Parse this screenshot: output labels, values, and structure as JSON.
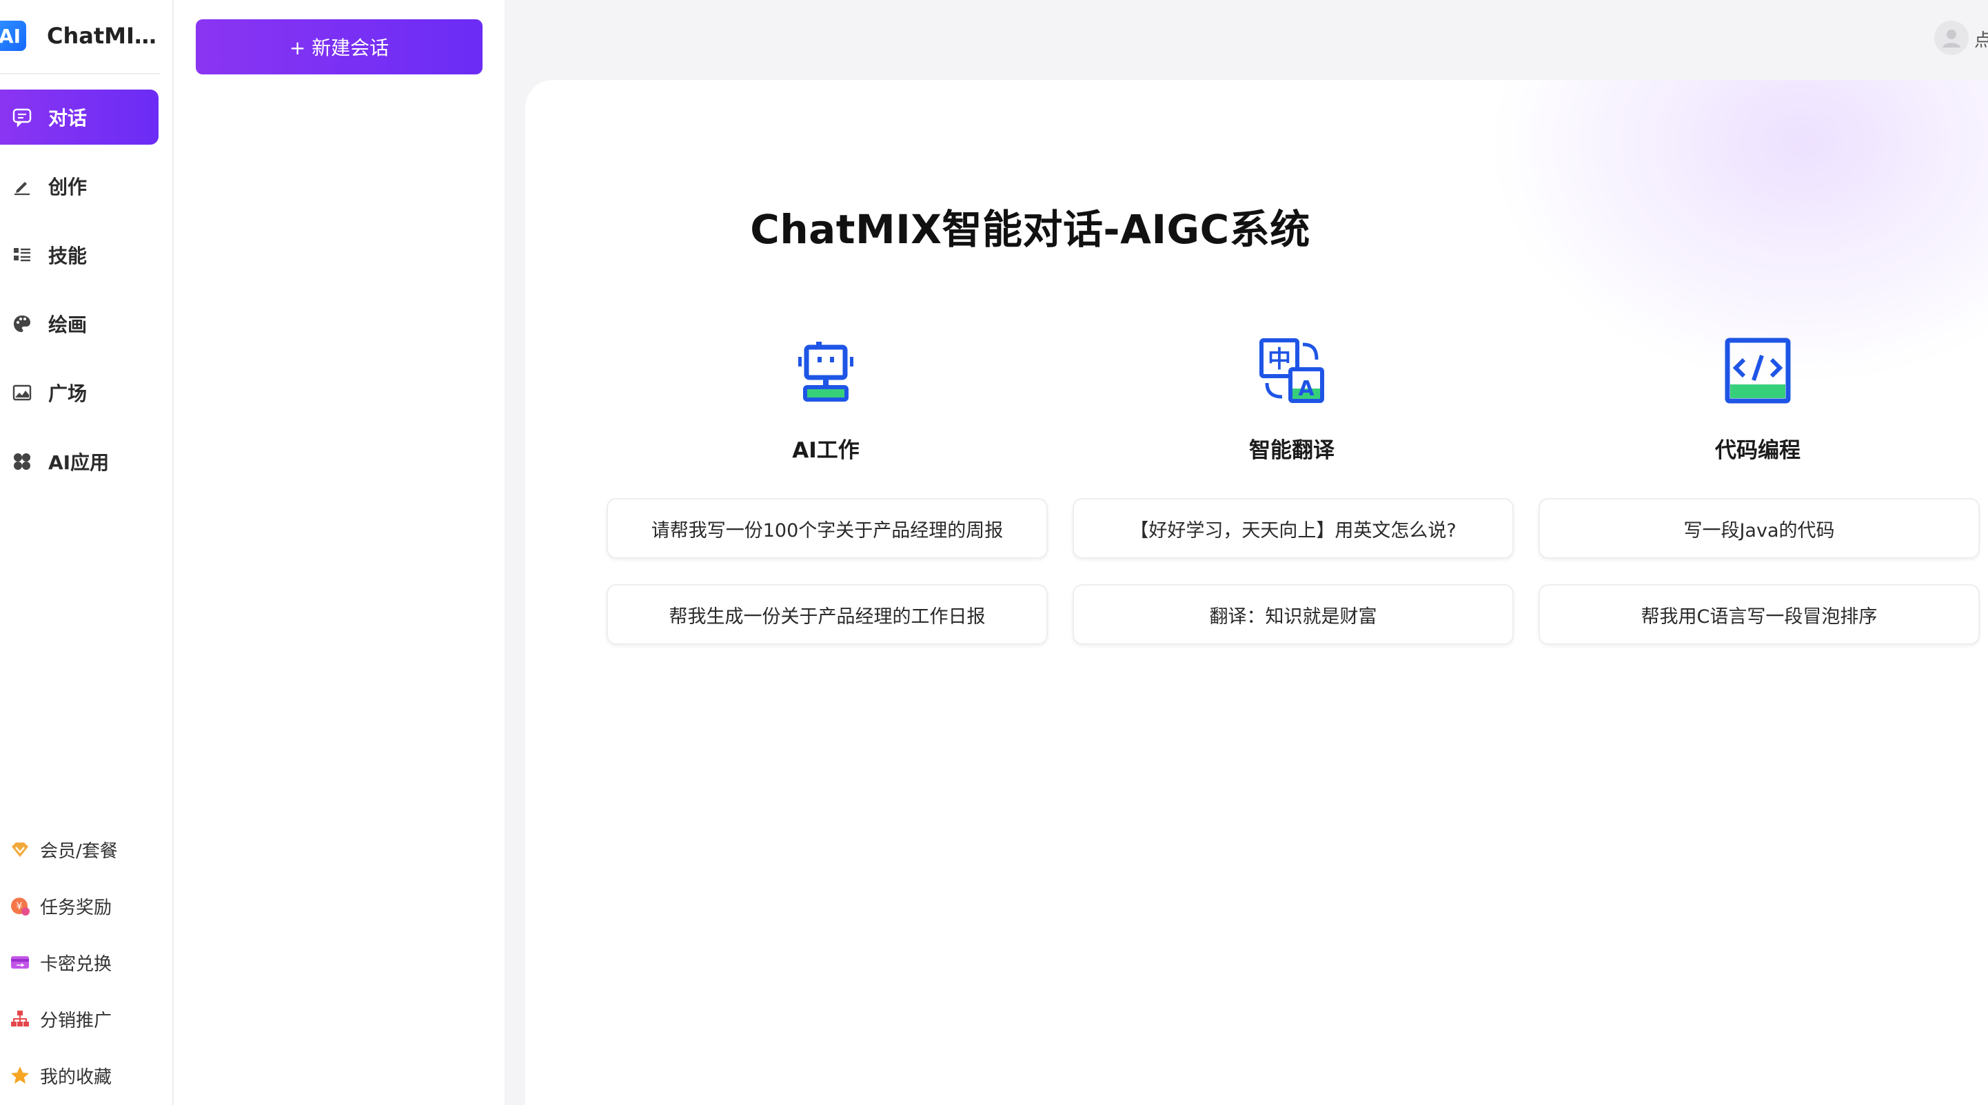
{
  "brand": {
    "logo_text": "AI",
    "name": "ChatMIX..."
  },
  "nav": {
    "items": [
      {
        "label": "对话",
        "icon": "chat-bubble-icon",
        "active": true
      },
      {
        "label": "创作",
        "icon": "pen-icon"
      },
      {
        "label": "技能",
        "icon": "list-icon"
      },
      {
        "label": "绘画",
        "icon": "palette-icon"
      },
      {
        "label": "广场",
        "icon": "image-icon"
      },
      {
        "label": "AI应用",
        "icon": "apps-grid-icon"
      }
    ],
    "bottom": [
      {
        "label": "会员/套餐",
        "icon": "vip-diamond-icon"
      },
      {
        "label": "任务奖励",
        "icon": "reward-coin-icon"
      },
      {
        "label": "卡密兑换",
        "icon": "card-exchange-icon"
      },
      {
        "label": "分销推广",
        "icon": "org-chart-icon"
      },
      {
        "label": "我的收藏",
        "icon": "star-icon"
      }
    ]
  },
  "sessions": {
    "new_chat_label": "+ 新建会话"
  },
  "header": {
    "avatar_text": "点"
  },
  "main": {
    "title": "ChatMIX智能对话-AIGC系统",
    "columns": [
      {
        "title": "AI工作",
        "icon": "robot-icon",
        "prompts": [
          "请帮我写一份100个字关于产品经理的周报",
          "帮我生成一份关于产品经理的工作日报"
        ]
      },
      {
        "title": "智能翻译",
        "icon": "translate-icon",
        "prompts": [
          "【好好学习，天天向上】用英文怎么说?",
          "翻译：知识就是财富"
        ]
      },
      {
        "title": "代码编程",
        "icon": "code-icon",
        "prompts": [
          "写一段Java的代码",
          "帮我用C语言写一段冒泡排序"
        ]
      }
    ]
  },
  "colors": {
    "accent_start": "#8a35f2",
    "accent_end": "#6b2cf5",
    "icon_blue": "#1f55e6",
    "icon_green": "#37d07a"
  }
}
